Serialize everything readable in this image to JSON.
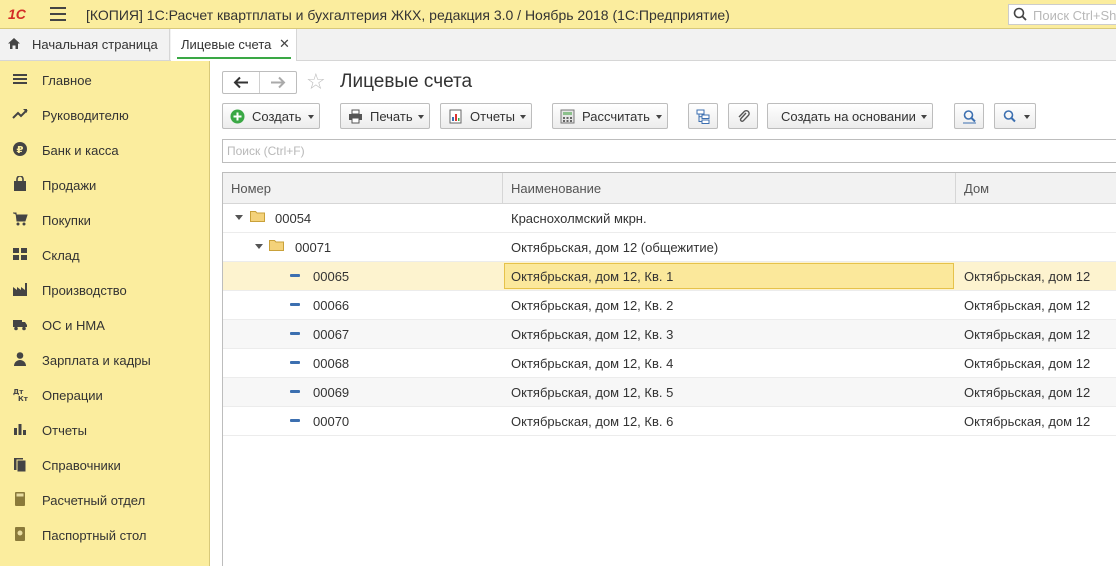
{
  "titlebar": {
    "logo": "1С",
    "title": "[КОПИЯ] 1С:Расчет квартплаты и бухгалтерия ЖКХ, редакция 3.0 / Ноябрь 2018  (1С:Предприятие)",
    "search_placeholder": "Поиск Ctrl+Shift+F"
  },
  "tabs": {
    "home": "Начальная страница",
    "active": "Лицевые счета",
    "close_symbol": "✕"
  },
  "sidebar": {
    "items": [
      {
        "label": "Главное",
        "icon": "menu-icon"
      },
      {
        "label": "Руководителю",
        "icon": "trend-icon"
      },
      {
        "label": "Банк и касса",
        "icon": "ruble-icon"
      },
      {
        "label": "Продажи",
        "icon": "bag-icon"
      },
      {
        "label": "Покупки",
        "icon": "cart-icon"
      },
      {
        "label": "Склад",
        "icon": "warehouse-icon"
      },
      {
        "label": "Производство",
        "icon": "factory-icon"
      },
      {
        "label": "ОС и НМА",
        "icon": "truck-icon"
      },
      {
        "label": "Зарплата и кадры",
        "icon": "person-icon"
      },
      {
        "label": "Операции",
        "icon": "dt-kt-icon"
      },
      {
        "label": "Отчеты",
        "icon": "bar-chart-icon"
      },
      {
        "label": "Справочники",
        "icon": "books-icon"
      },
      {
        "label": "Расчетный отдел",
        "icon": "calculator-icon"
      },
      {
        "label": "Паспортный стол",
        "icon": "passport-icon"
      }
    ]
  },
  "form": {
    "title": "Лицевые счета",
    "star": "☆",
    "search_placeholder": "Поиск (Ctrl+F)"
  },
  "toolbar": {
    "create": "Создать",
    "print": "Печать",
    "reports": "Отчеты",
    "calculate": "Рассчитать",
    "create_based_on": "Создать на основании"
  },
  "table": {
    "columns": [
      "Номер",
      "Наименование",
      "Дом"
    ],
    "rows": [
      {
        "number": "00054",
        "name": "Краснохолмский мкрн.",
        "house": "",
        "level": 0,
        "kind": "group"
      },
      {
        "number": "00071",
        "name": "Октябрьская, дом 12 (общежитие)",
        "house": "",
        "level": 1,
        "kind": "group"
      },
      {
        "number": "00065",
        "name": "Октябрьская, дом 12, Кв. 1",
        "house": "Октябрьская, дом 12",
        "level": 2,
        "kind": "item",
        "selected": true
      },
      {
        "number": "00066",
        "name": "Октябрьская, дом 12, Кв. 2",
        "house": "Октябрьская, дом 12",
        "level": 2,
        "kind": "item"
      },
      {
        "number": "00067",
        "name": "Октябрьская, дом 12, Кв. 3",
        "house": "Октябрьская, дом 12",
        "level": 2,
        "kind": "item"
      },
      {
        "number": "00068",
        "name": "Октябрьская, дом 12, Кв. 4",
        "house": "Октябрьская, дом 12",
        "level": 2,
        "kind": "item"
      },
      {
        "number": "00069",
        "name": "Октябрьская, дом 12, Кв. 5",
        "house": "Октябрьская, дом 12",
        "level": 2,
        "kind": "item"
      },
      {
        "number": "00070",
        "name": "Октябрьская, дом 12, Кв. 6",
        "house": "Октябрьская, дом 12",
        "level": 2,
        "kind": "item"
      }
    ]
  },
  "colors": {
    "panel": "#fbed9e",
    "selection": "#fbe89b",
    "accent_green": "#3aa845"
  }
}
